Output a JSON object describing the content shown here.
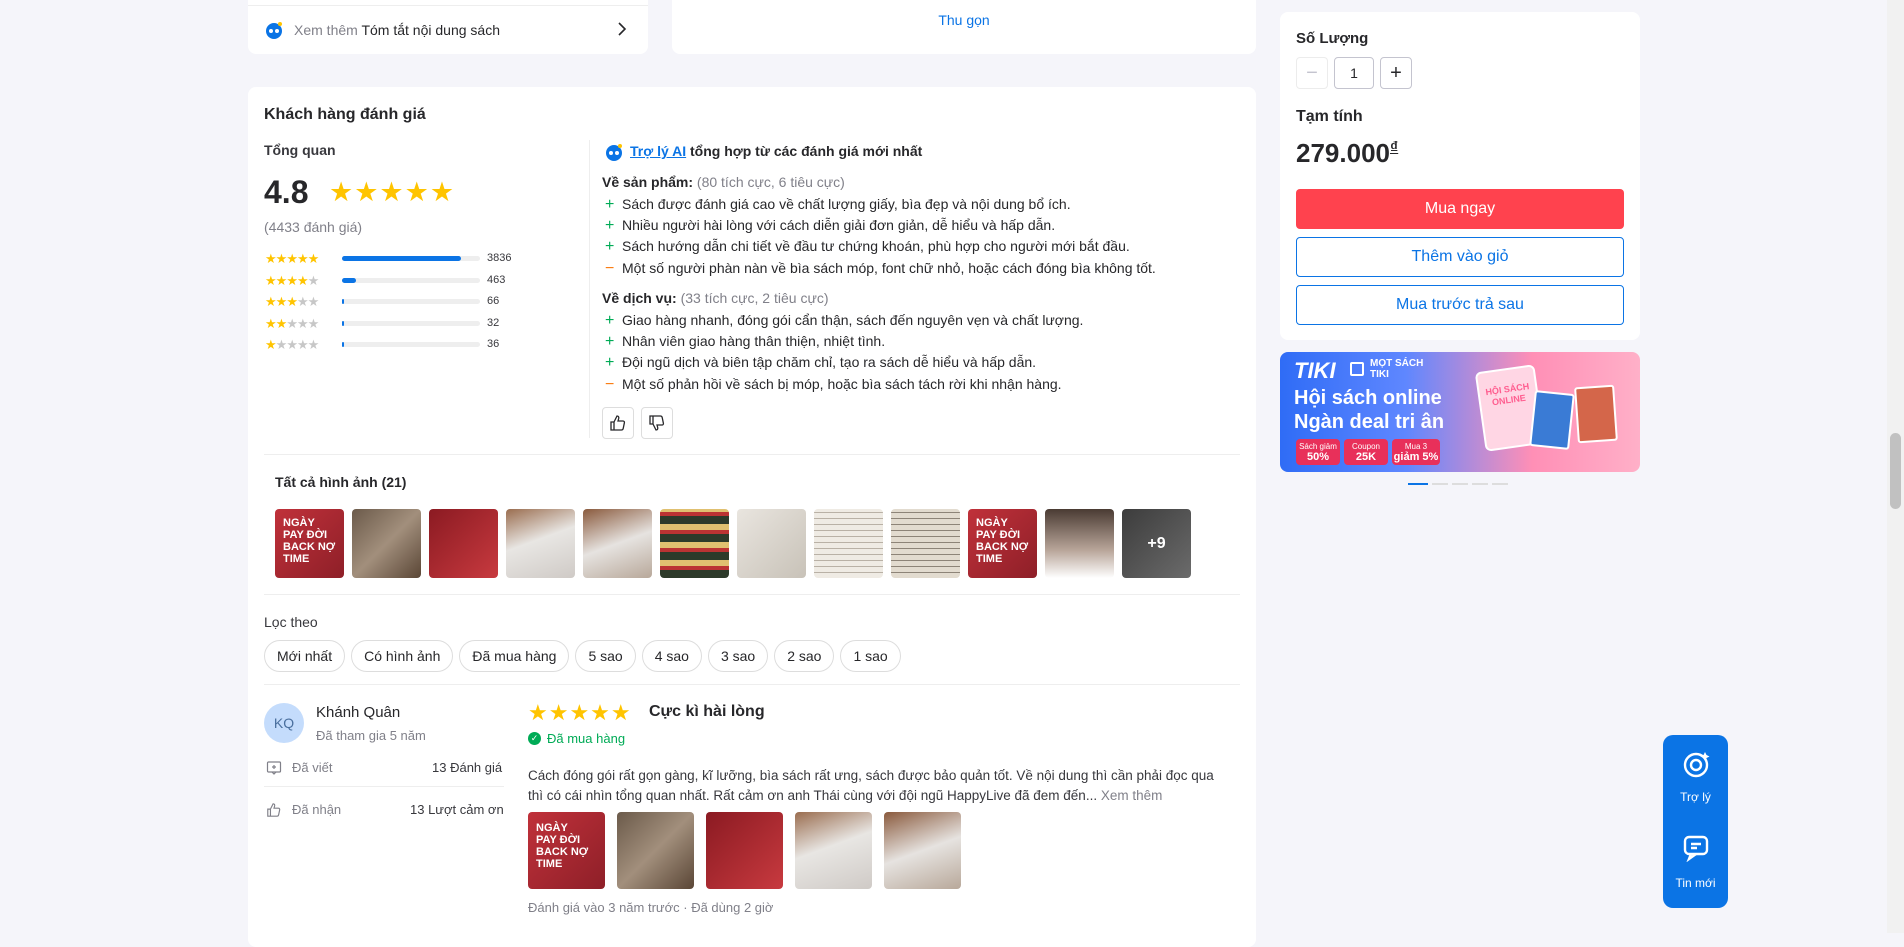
{
  "summary_link": {
    "prefix": "Xem thêm",
    "label": "Tóm tắt nội dung sách"
  },
  "collapse_label": "Thu gọn",
  "purchase": {
    "qty_label": "Số Lượng",
    "qty_value": "1",
    "subtotal_label": "Tạm tính",
    "price": "279.000",
    "currency": "₫",
    "buy_now": "Mua ngay",
    "add_cart": "Thêm vào giỏ",
    "bnpl": "Mua trước trả sau"
  },
  "banner": {
    "brand": "TIKI",
    "tag1": "MỌT SÁCH",
    "tag2": "TIKI",
    "title1": "Hội sách online",
    "title2": "Ngàn deal tri ân",
    "badge1a": "Sách giảm",
    "badge1b": "50%",
    "badge2a": "Coupon",
    "badge2b": "25K",
    "badge3a": "Mua 3",
    "badge3b": "giảm 5%",
    "book_text1": "HỘI SÁCH",
    "book_text2": "ONLINE"
  },
  "reviews": {
    "title": "Khách hàng đánh giá",
    "overview_label": "Tổng quan",
    "average": "4.8",
    "total": "(4433 đánh giá)",
    "rows": [
      {
        "stars": 5,
        "count": "3836",
        "fraction": 0.865
      },
      {
        "stars": 4,
        "count": "463",
        "fraction": 0.105
      },
      {
        "stars": 3,
        "count": "66",
        "fraction": 0.015
      },
      {
        "stars": 2,
        "count": "32",
        "fraction": 0.008
      },
      {
        "stars": 1,
        "count": "36",
        "fraction": 0.008
      }
    ],
    "ai": {
      "link": "Trợ lý AI",
      "text": "tổng hợp từ các đánh giá mới nhất",
      "product_label": "Về sản phẩm:",
      "product_counts": "(80 tích cực, 6 tiêu cực)",
      "product_items": [
        {
          "sign": "+",
          "text": "Sách được đánh giá cao về chất lượng giấy, bìa đẹp và nội dung bổ ích."
        },
        {
          "sign": "+",
          "text": "Nhiều người hài lòng với cách diễn giải đơn giản, dễ hiểu và hấp dẫn."
        },
        {
          "sign": "+",
          "text": "Sách hướng dẫn chi tiết về đầu tư chứng khoán, phù hợp cho người mới bắt đầu."
        },
        {
          "sign": "−",
          "text": "Một số người phàn nàn về bìa sách móp, font chữ nhỏ, hoặc cách đóng bìa không tốt."
        }
      ],
      "service_label": "Về dịch vụ:",
      "service_counts": "(33 tích cực, 2 tiêu cực)",
      "service_items": [
        {
          "sign": "+",
          "text": "Giao hàng nhanh, đóng gói cẩn thận, sách đến nguyên vẹn và chất lượng."
        },
        {
          "sign": "+",
          "text": "Nhân viên giao hàng thân thiện, nhiệt tình."
        },
        {
          "sign": "+",
          "text": "Đội ngũ dịch và biên tập chăm chỉ, tạo ra sách dễ hiểu và hấp dẫn."
        },
        {
          "sign": "−",
          "text": "Một số phản hồi về sách bị móp, hoặc bìa sách tách rời khi nhận hàng."
        }
      ]
    },
    "images_title": "Tất cả hình ảnh (21)",
    "images_more": "+9",
    "cover_words": [
      "NGÀY",
      "PAY ĐỜI",
      "BACK NỢ",
      "TIME"
    ],
    "filter_label": "Lọc theo",
    "filters": [
      "Mới nhất",
      "Có hình ảnh",
      "Đã mua hàng",
      "5 sao",
      "4 sao",
      "3 sao",
      "2 sao",
      "1 sao"
    ],
    "review": {
      "initials": "KQ",
      "name": "Khánh Quân",
      "joined": "Đã tham gia 5 năm",
      "written_label": "Đã viết",
      "written_value": "13 Đánh giá",
      "thanks_label": "Đã nhận",
      "thanks_value": "13 Lượt cảm ơn",
      "rating": 5,
      "headline": "Cực kì hài lòng",
      "purchased": "Đã mua hàng",
      "content": "Cách đóng gói rất gọn gàng, kĩ lưỡng, bìa sách rất ưng, sách được bảo quản tốt. Về nội dung thì cần phải đọc qua thì có cái nhìn tổng quan nhất. Rất cảm ơn anh Thái cùng với đội ngũ HappyLive đã đem đến...",
      "see_more": "Xem thêm",
      "date": "Đánh giá vào 3 năm trước",
      "used": "Đã dùng 2 giờ"
    }
  },
  "float": {
    "assistant": "Trợ lý",
    "news": "Tin mới"
  },
  "colors": {
    "primary": "#0b74e5",
    "buy": "#ff424e",
    "star": "#ffc400",
    "green": "#00ab56"
  }
}
